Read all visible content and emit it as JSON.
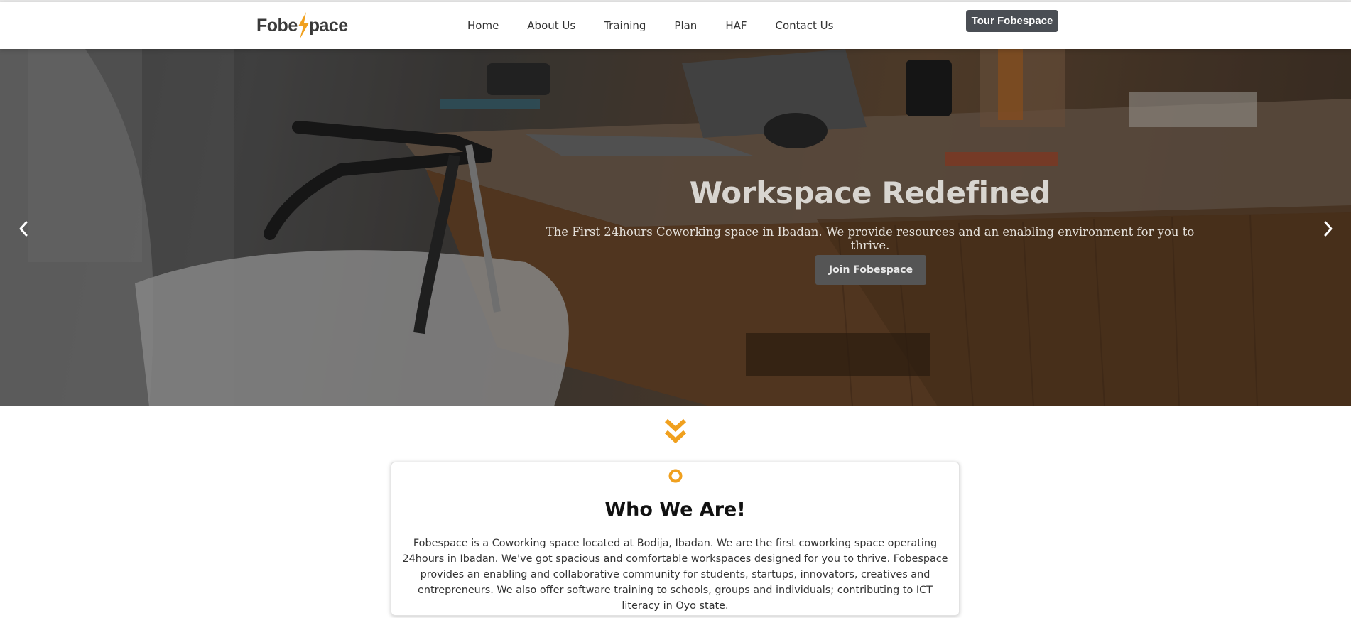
{
  "brand": {
    "logo_prefix": "Fobe",
    "logo_suffix": "pace",
    "accent_color": "#f0a01e"
  },
  "nav": {
    "links": [
      {
        "label": "Home"
      },
      {
        "label": "About Us"
      },
      {
        "label": "Training"
      },
      {
        "label": "Plan"
      },
      {
        "label": "HAF"
      },
      {
        "label": "Contact Us"
      }
    ],
    "tour_button": "Tour Fobespace"
  },
  "hero": {
    "title": "Workspace Redefined",
    "subtitle": "The First 24hours Coworking space in Ibadan. We provide resources and an enabling environment for you to thrive.",
    "cta": "Join Fobespace",
    "prev_icon": "chevron-left-icon",
    "next_icon": "chevron-right-icon"
  },
  "scroll_icon": "double-chevron-down-icon",
  "about": {
    "icon": "circle-dot-icon",
    "title": "Who We Are!",
    "text": "Fobespace is a Coworking space located at Bodija, Ibadan. We are the first coworking space operating 24hours in Ibadan. We've got spacious and comfortable workspaces designed for you to thrive. Fobespace provides an enabling and collaborative community for students, startups, innovators, creatives and entrepreneurs. We also offer software training to schools, groups and individuals; contributing to ICT literacy in Oyo state."
  }
}
